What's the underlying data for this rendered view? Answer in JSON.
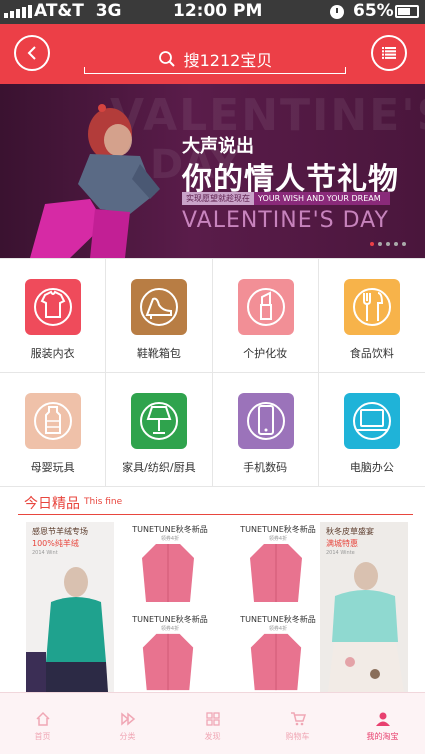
{
  "status_bar": {
    "carrier": "AT&T",
    "network": "3G",
    "time": "12:00 PM",
    "battery": "65%",
    "battery_level": 0.65
  },
  "header": {
    "search_text": "搜1212宝贝",
    "back_icon": "chevron-left-icon",
    "menu_icon": "list-icon"
  },
  "banner": {
    "small_title": "大声说出",
    "big_title": "你的情人节礼物",
    "tagline_cn": "实现愿望就趁现在",
    "tagline_en": "YOUR WISH AND YOUR DREAM",
    "english_title": "VALENTINE'S DAY",
    "slide_count": 5,
    "active_slide": 1
  },
  "categories": [
    {
      "label": "服装内衣",
      "icon": "tshirt-icon",
      "color": "#ef4b5b"
    },
    {
      "label": "鞋靴箱包",
      "icon": "high-heel-icon",
      "color": "#b87d44"
    },
    {
      "label": "个护化妆",
      "icon": "lipstick-icon",
      "color": "#f28f96"
    },
    {
      "label": "食品饮料",
      "icon": "utensils-icon",
      "color": "#f7b34a"
    },
    {
      "label": "母婴玩具",
      "icon": "baby-bottle-icon",
      "color": "#efc1a9"
    },
    {
      "label": "家具/纺织/厨具",
      "icon": "lamp-icon",
      "color": "#2fa34d"
    },
    {
      "label": "手机数码",
      "icon": "phone-icon",
      "color": "#9b73ba"
    },
    {
      "label": "电脑办公",
      "icon": "laptop-icon",
      "color": "#1fb3d8"
    }
  ],
  "today": {
    "title": "今日精品",
    "subtitle": "This fine"
  },
  "products": {
    "left": {
      "title": "感恩节羊绒专场",
      "sub": "100%纯羊绒",
      "tiny": "2014 Wint"
    },
    "right": {
      "title": "秋冬皮草盛宴",
      "sub": "满城特惠",
      "tiny": "2014 Winte"
    },
    "middle": [
      {
        "title": "TUNETUNE秋冬新品",
        "sub": "领券4折"
      },
      {
        "title": "TUNETUNE秋冬新品",
        "sub": "领券4折"
      },
      {
        "title": "TUNETUNE秋冬新品",
        "sub": "领券4折"
      },
      {
        "title": "TUNETUNE秋冬新品",
        "sub": "领券4折"
      }
    ]
  },
  "tabbar": [
    {
      "label": "首页",
      "icon": "home-icon"
    },
    {
      "label": "分类",
      "icon": "play-icon"
    },
    {
      "label": "发现",
      "icon": "grid-icon"
    },
    {
      "label": "购物车",
      "icon": "cart-icon"
    },
    {
      "label": "我的淘宝",
      "icon": "user-icon",
      "active": true
    }
  ]
}
